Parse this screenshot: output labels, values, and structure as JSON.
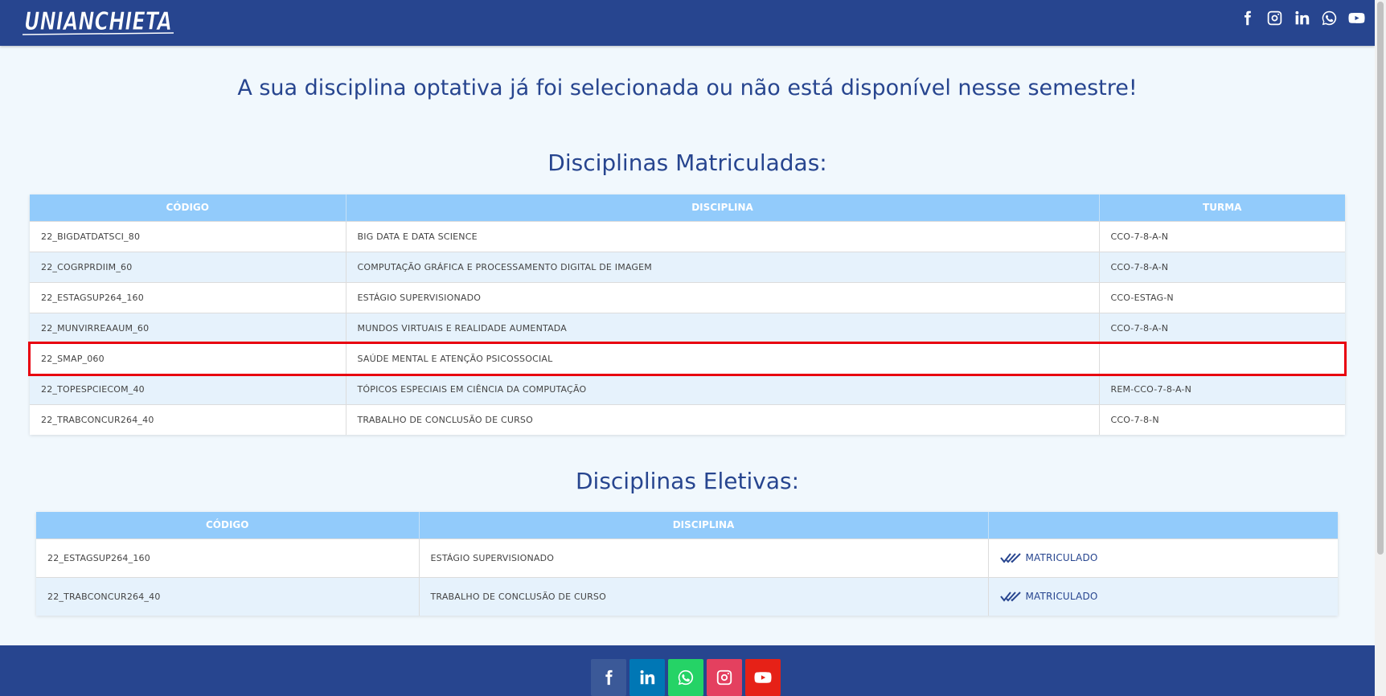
{
  "brand": {
    "logo_text": "UNIANCHIETA"
  },
  "header_social": [
    "facebook-icon",
    "instagram-icon",
    "linkedin-icon",
    "whatsapp-icon",
    "youtube-icon"
  ],
  "message": "A sua disciplina optativa já foi selecionada ou não está disponível nesse semestre!",
  "enrolled": {
    "title": "Disciplinas Matriculadas:",
    "headers": [
      "CÓDIGO",
      "DISCIPLINA",
      "TURMA"
    ],
    "rows": [
      {
        "codigo": "22_BIGDATDATSCI_80",
        "disciplina": "BIG DATA E DATA SCIENCE",
        "turma": "CCO-7-8-A-N"
      },
      {
        "codigo": "22_COGRPRDIIM_60",
        "disciplina": "COMPUTAÇÃO GRÁFICA E PROCESSAMENTO DIGITAL DE IMAGEM",
        "turma": "CCO-7-8-A-N"
      },
      {
        "codigo": "22_ESTAGSUP264_160",
        "disciplina": "ESTÁGIO SUPERVISIONADO",
        "turma": "CCO-ESTAG-N"
      },
      {
        "codigo": "22_MUNVIRREAAUM_60",
        "disciplina": "MUNDOS VIRTUAIS E REALIDADE AUMENTADA",
        "turma": "CCO-7-8-A-N"
      },
      {
        "codigo": "22_SMAP_060",
        "disciplina": "SAÚDE MENTAL E ATENÇÃO PSICOSSOCIAL",
        "turma": ""
      },
      {
        "codigo": "22_TOPESPCIECOM_40",
        "disciplina": "TÓPICOS ESPECIAIS EM CIÊNCIA DA COMPUTAÇÃO",
        "turma": "REM-CCO-7-8-A-N"
      },
      {
        "codigo": "22_TRABCONCUR264_40",
        "disciplina": "TRABALHO DE CONCLUSÃO DE CURSO",
        "turma": "CCO-7-8-N"
      }
    ],
    "highlighted_row_index": 4,
    "highlight_color": "#e8000f"
  },
  "electives": {
    "title": "Disciplinas Eletivas:",
    "headers": [
      "CÓDIGO",
      "DISCIPLINA",
      ""
    ],
    "rows": [
      {
        "codigo": "22_ESTAGSUP264_160",
        "disciplina": "ESTÁGIO SUPERVISIONADO",
        "status": "MATRICULADO"
      },
      {
        "codigo": "22_TRABCONCUR264_40",
        "disciplina": "TRABALHO DE CONCLUSÃO DE CURSO",
        "status": "MATRICULADO"
      }
    ]
  },
  "footer_social": [
    {
      "icon": "facebook-icon",
      "color": "#3b5998"
    },
    {
      "icon": "linkedin-icon",
      "color": "#0077b5"
    },
    {
      "icon": "whatsapp-icon",
      "color": "#25d366"
    },
    {
      "icon": "instagram-icon",
      "color": "#e4405f"
    },
    {
      "icon": "youtube-icon",
      "color": "#e62117"
    }
  ],
  "colors": {
    "header_bg": "#27458f",
    "table_header_bg": "#92cbfb",
    "row_alt_bg": "#e6f2fc",
    "page_bg": "#f1f8fd"
  }
}
